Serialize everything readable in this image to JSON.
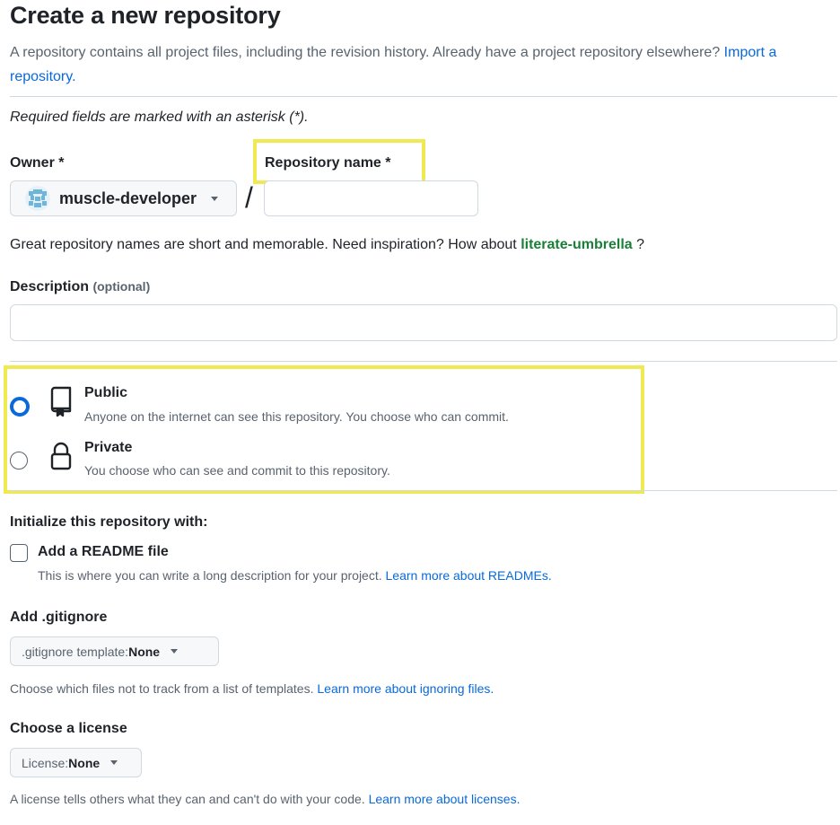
{
  "page": {
    "title": "Create a new repository",
    "intro": "A repository contains all project files, including the revision history. Already have a project repository elsewhere?",
    "import_link": "Import a repository.",
    "required_note": "Required fields are marked with an asterisk (*)."
  },
  "owner": {
    "label": "Owner *",
    "value": "muscle-developer",
    "avatar_icon": "pixel-avatar-icon"
  },
  "separator": "/",
  "repo_name": {
    "label": "Repository name *",
    "value": "",
    "placeholder": ""
  },
  "name_hint": {
    "text": "Great repository names are short and memorable. Need inspiration? How about",
    "suggestion": "literate-umbrella",
    "suffix": "?"
  },
  "description": {
    "label": "Description",
    "optional": "(optional)",
    "value": "",
    "placeholder": ""
  },
  "visibility": {
    "options": [
      {
        "label": "Public",
        "description": "Anyone on the internet can see this repository. You choose who can commit.",
        "selected": true,
        "icon": "repo-icon"
      },
      {
        "label": "Private",
        "description": "You choose who can see and commit to this repository.",
        "selected": false,
        "icon": "lock-icon"
      }
    ]
  },
  "initialize": {
    "heading": "Initialize this repository with:",
    "readme_label": "Add a README file",
    "readme_checked": false,
    "readme_hint": "This is where you can write a long description for your project.",
    "readme_link": "Learn more about READMEs."
  },
  "gitignore": {
    "heading": "Add .gitignore",
    "button_prefix": ".gitignore template:",
    "button_value": "None",
    "hint": "Choose which files not to track from a list of templates.",
    "link": "Learn more about ignoring files."
  },
  "license": {
    "heading": "Choose a license",
    "button_prefix": "License:",
    "button_value": "None",
    "hint": "A license tells others what they can and can't do with your code.",
    "link": "Learn more about licenses."
  },
  "colors": {
    "accent": "#0969da",
    "suggestion": "#1a7f37",
    "highlight": "#f0ea52",
    "border": "#d1d9e0",
    "muted": "#59636e"
  }
}
